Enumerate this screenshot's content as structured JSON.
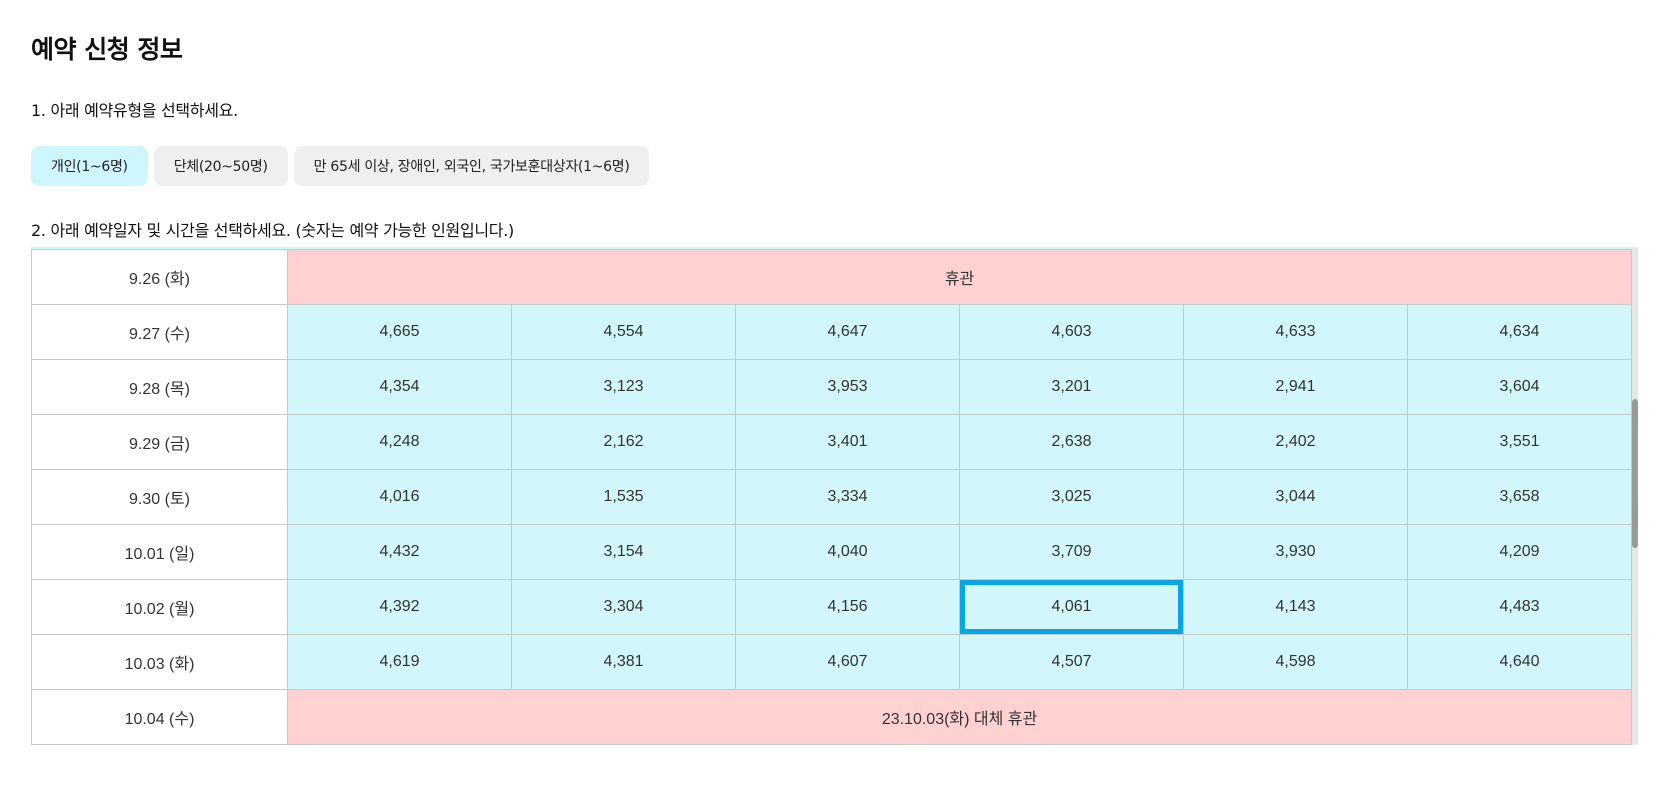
{
  "page": {
    "title": "예약 신청 정보",
    "step1_text": "1. 아래 예약유형을 선택하세요.",
    "step2_text": "2. 아래 예약일자 및 시간을 선택하세요. (숫자는 예약 가능한 인원입니다.)"
  },
  "reservation_types": [
    {
      "label": "개인(1~6명)",
      "selected": true
    },
    {
      "label": "단체(20~50명)",
      "selected": false
    },
    {
      "label": "만 65세 이상, 장애인, 외국인, 국가보훈대상자(1~6명)",
      "selected": false
    }
  ],
  "schedule": {
    "rows": [
      {
        "date": "9.26 (화)",
        "closed": true,
        "note": "휴관"
      },
      {
        "date": "9.27 (수)",
        "closed": false,
        "slots": [
          "4,665",
          "4,554",
          "4,647",
          "4,603",
          "4,633",
          "4,634"
        ]
      },
      {
        "date": "9.28 (목)",
        "closed": false,
        "slots": [
          "4,354",
          "3,123",
          "3,953",
          "3,201",
          "2,941",
          "3,604"
        ]
      },
      {
        "date": "9.29 (금)",
        "closed": false,
        "slots": [
          "4,248",
          "2,162",
          "3,401",
          "2,638",
          "2,402",
          "3,551"
        ]
      },
      {
        "date": "9.30 (토)",
        "closed": false,
        "slots": [
          "4,016",
          "1,535",
          "3,334",
          "3,025",
          "3,044",
          "3,658"
        ]
      },
      {
        "date": "10.01 (일)",
        "closed": false,
        "slots": [
          "4,432",
          "3,154",
          "4,040",
          "3,709",
          "3,930",
          "4,209"
        ]
      },
      {
        "date": "10.02 (월)",
        "closed": false,
        "slots": [
          "4,392",
          "3,304",
          "4,156",
          "4,061",
          "4,143",
          "4,483"
        ]
      },
      {
        "date": "10.03 (화)",
        "closed": false,
        "slots": [
          "4,619",
          "4,381",
          "4,607",
          "4,507",
          "4,598",
          "4,640"
        ]
      },
      {
        "date": "10.04 (수)",
        "closed": true,
        "note": "23.10.03(화) 대체 휴관"
      }
    ],
    "selected_row": 6,
    "selected_slot": 3
  },
  "scrollbar": {
    "position": 0.32,
    "visible_fraction": 0.3
  },
  "colors": {
    "available_slot": "#d1f7fb",
    "closed_day": "#ffd1d1",
    "selected_border": "#0aa5e4",
    "active_type": "#cdf6fd",
    "inactive_type": "#efefef"
  }
}
